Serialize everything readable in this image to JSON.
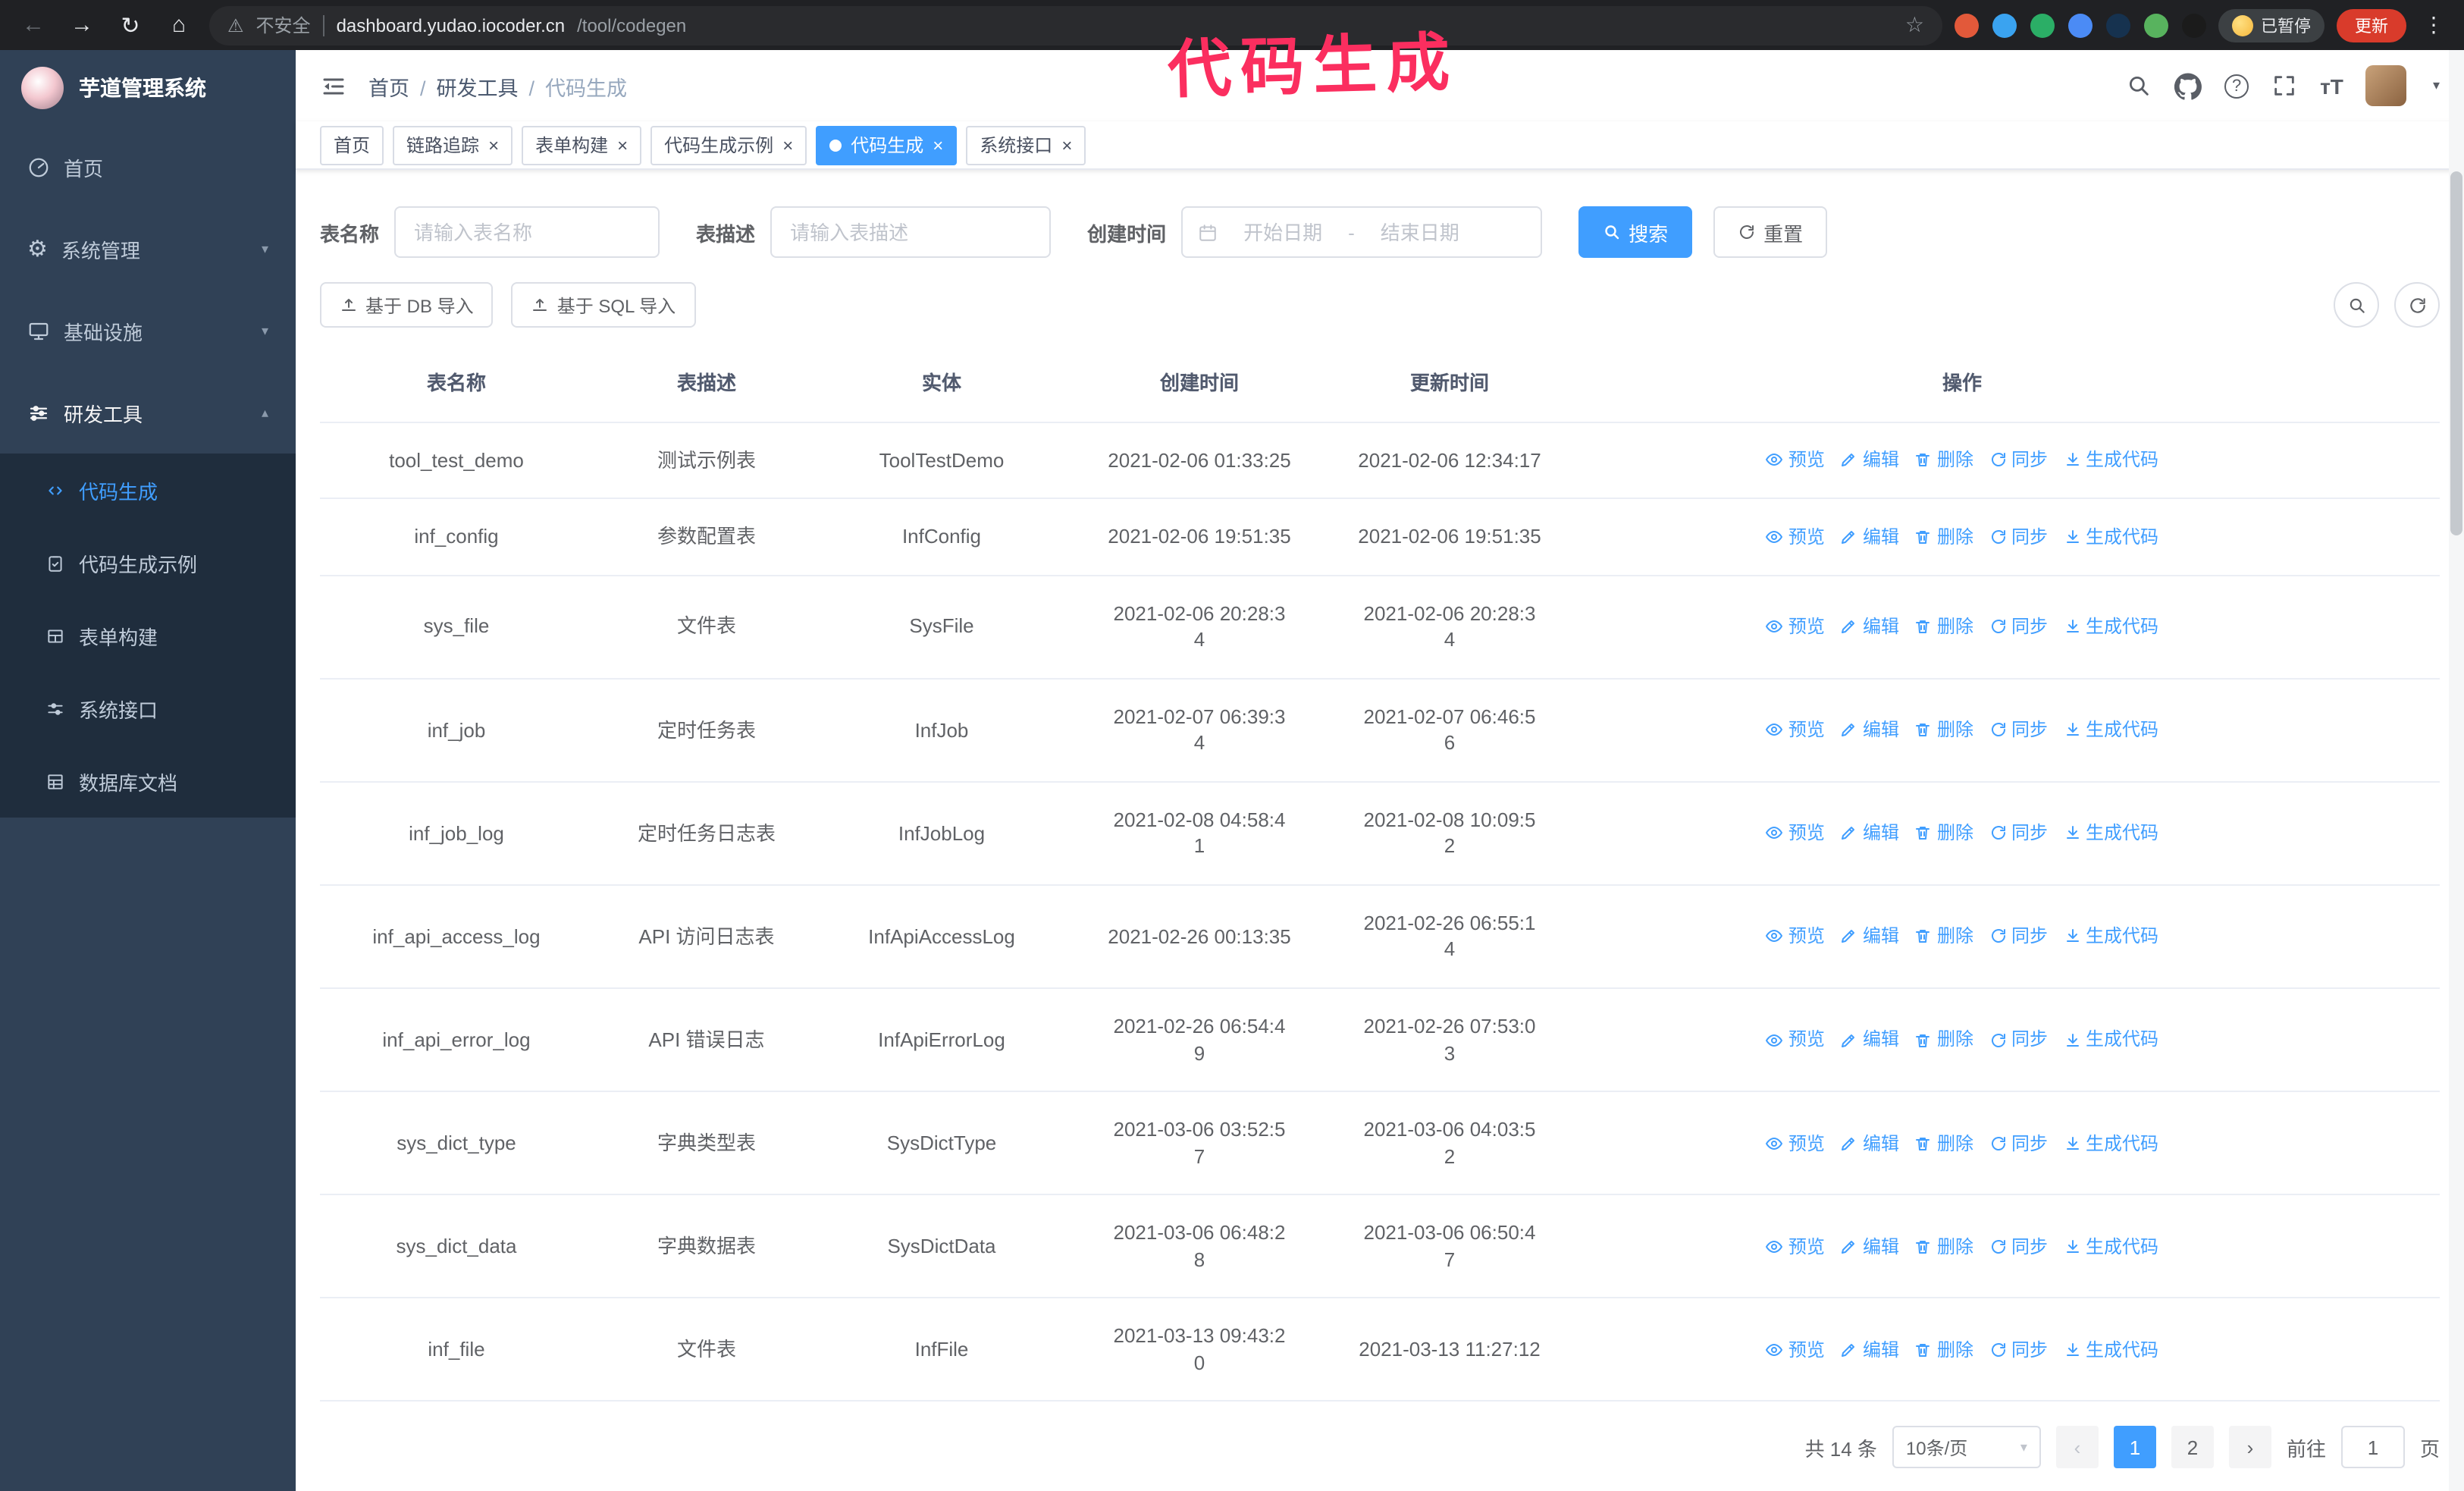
{
  "colors": {
    "accent": "#409eff",
    "sidebar_bg": "#304156",
    "submenu_bg": "#1f2d3d",
    "annotation": "#fb2e5f",
    "update_button_bg": "#d93b2b",
    "link": "#409eff"
  },
  "annotation": {
    "text": "代码生成"
  },
  "browser": {
    "insecure_label": "不安全",
    "url_host": "dashboard.yudao.iocoder.cn",
    "url_path": "/tool/codegen",
    "paused_badge": "已暂停",
    "update_button": "更新",
    "extensions": [
      {
        "name": "extension-1",
        "color": "#e2593a"
      },
      {
        "name": "extension-2",
        "color": "#3aa3f0"
      },
      {
        "name": "extension-3",
        "color": "#2bae66"
      },
      {
        "name": "extension-4",
        "color": "#4b8bf5"
      },
      {
        "name": "extension-5",
        "color": "#16324f"
      },
      {
        "name": "extension-6",
        "color": "#58b35e"
      },
      {
        "name": "extension-7",
        "color": "#1b1b1b"
      }
    ]
  },
  "sidebar": {
    "title": "芋道管理系统",
    "items": [
      {
        "label": "首页"
      },
      {
        "label": "系统管理"
      },
      {
        "label": "基础设施"
      },
      {
        "label": "研发工具",
        "children": [
          {
            "label": "代码生成",
            "active": true
          },
          {
            "label": "代码生成示例"
          },
          {
            "label": "表单构建"
          },
          {
            "label": "系统接口"
          },
          {
            "label": "数据库文档"
          }
        ]
      }
    ]
  },
  "header": {
    "breadcrumb": [
      "首页",
      "研发工具",
      "代码生成"
    ]
  },
  "tabs": [
    {
      "label": "首页",
      "closable": false
    },
    {
      "label": "链路追踪",
      "closable": true
    },
    {
      "label": "表单构建",
      "closable": true
    },
    {
      "label": "代码生成示例",
      "closable": true
    },
    {
      "label": "代码生成",
      "closable": true,
      "active": true
    },
    {
      "label": "系统接口",
      "closable": true
    }
  ],
  "filter": {
    "name_label": "表名称",
    "name_placeholder": "请输入表名称",
    "desc_label": "表描述",
    "desc_placeholder": "请输入表描述",
    "time_label": "创建时间",
    "start_placeholder": "开始日期",
    "range_separator": "-",
    "end_placeholder": "结束日期",
    "search_button": "搜索",
    "reset_button": "重置"
  },
  "toolbar": {
    "db_import_button": "基于 DB 导入",
    "sql_import_button": "基于 SQL 导入"
  },
  "table": {
    "columns": [
      "表名称",
      "表描述",
      "实体",
      "创建时间",
      "更新时间",
      "操作"
    ],
    "actions": [
      "预览",
      "编辑",
      "删除",
      "同步",
      "生成代码"
    ],
    "rows": [
      {
        "name": "tool_test_demo",
        "desc": "测试示例表",
        "entity": "ToolTestDemo",
        "created": "2021-02-06 01:33:25",
        "updated": "2021-02-06 12:34:17"
      },
      {
        "name": "inf_config",
        "desc": "参数配置表",
        "entity": "InfConfig",
        "created": "2021-02-06 19:51:35",
        "updated": "2021-02-06 19:51:35"
      },
      {
        "name": "sys_file",
        "desc": "文件表",
        "entity": "SysFile",
        "created": "2021-02-06 20:28:3\n4",
        "updated": "2021-02-06 20:28:3\n4"
      },
      {
        "name": "inf_job",
        "desc": "定时任务表",
        "entity": "InfJob",
        "created": "2021-02-07 06:39:3\n4",
        "updated": "2021-02-07 06:46:5\n6"
      },
      {
        "name": "inf_job_log",
        "desc": "定时任务日志表",
        "entity": "InfJobLog",
        "created": "2021-02-08 04:58:4\n1",
        "updated": "2021-02-08 10:09:5\n2"
      },
      {
        "name": "inf_api_access_log",
        "desc": "API 访问日志表",
        "entity": "InfApiAccessLog",
        "created": "2021-02-26 00:13:35",
        "updated": "2021-02-26 06:55:1\n4"
      },
      {
        "name": "inf_api_error_log",
        "desc": "API 错误日志",
        "entity": "InfApiErrorLog",
        "created": "2021-02-26 06:54:4\n9",
        "updated": "2021-02-26 07:53:0\n3"
      },
      {
        "name": "sys_dict_type",
        "desc": "字典类型表",
        "entity": "SysDictType",
        "created": "2021-03-06 03:52:5\n7",
        "updated": "2021-03-06 04:03:5\n2"
      },
      {
        "name": "sys_dict_data",
        "desc": "字典数据表",
        "entity": "SysDictData",
        "created": "2021-03-06 06:48:2\n8",
        "updated": "2021-03-06 06:50:4\n7"
      },
      {
        "name": "inf_file",
        "desc": "文件表",
        "entity": "InfFile",
        "created": "2021-03-13 09:43:2\n0",
        "updated": "2021-03-13 11:27:12"
      }
    ]
  },
  "pagination": {
    "total_label": "共 14 条",
    "page_size": "10条/页",
    "pages": [
      "1",
      "2"
    ],
    "active_page": "1",
    "goto_label": "前往",
    "goto_value": "1",
    "page_unit": "页"
  }
}
